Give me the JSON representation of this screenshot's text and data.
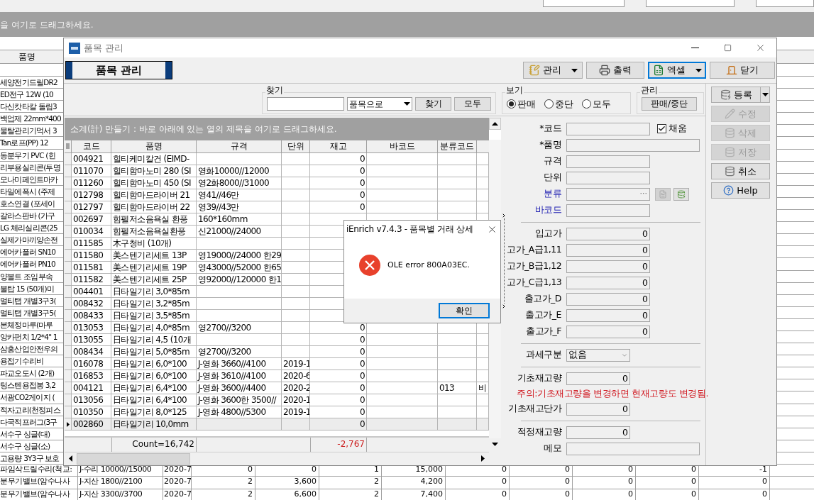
{
  "background_window": {
    "drop_hint": "을 여기로 드래그하세요.",
    "column_header": "품명",
    "list_rows": [
      "세양전기드릴DR2",
      "ED전구 12W (10",
      "다신캇타칼  돌림3",
      "백업제 22mm*400",
      "물탈관리기먹서 3",
      "Tan로프(PP)  12",
      "동분무기 PVC (힌",
      "리부용실리콘(투명",
      "모나미페인트마카",
      "타일에폭시 (주제",
      "호스연결 (포세이",
      "갈라스판바 (가구",
      "LG 체리실리콘(25",
      "실제가마끼양손전",
      "에어카플러 SN10",
      "에어카플러 PN10",
      "양볼트 조임부속",
      "불탑 15 (50개)미",
      "멀티탭 개별3구3(",
      "멀티탭 개별3구5(",
      "본체정마루(마루",
      "앙카펀치 1/2*4\" 1",
      "삼홍산업안전우의",
      "용접기수리비",
      "파교오도시 (2개)",
      "텅스텐용접봉 3,2",
      "서광CO2게이지 (",
      "적자고리(천정피스",
      "다국적프러그(3구",
      "서수구 싱글(대)",
      "서수구 싱글(소)",
      "고용량 3Y3구 보호"
    ],
    "bottom_rows": [
      {
        "name": "파임삭드릴수리(척교:",
        "spec": "J-수리 10000//15000",
        "date": "2020-7",
        "values": [
          "0",
          "0",
          "1",
          "15,000",
          "0",
          "0",
          "0",
          "0",
          "-1"
        ]
      },
      {
        "name": "분무기밸브(암수나사",
        "spec": "J-지산 1800//2100",
        "date": "2020-7",
        "values": [
          "2",
          "3,600",
          "2",
          "4,200",
          "0",
          "0",
          "0",
          "0",
          "0"
        ]
      },
      {
        "name": "분무기밸브(암수나사",
        "spec": "J-지산 3300//3700",
        "date": "2020-7",
        "values": [
          "2",
          "6,600",
          "2",
          "7,400",
          "0",
          "0",
          "0",
          "0",
          "0"
        ]
      }
    ]
  },
  "window": {
    "title": "품목 관리",
    "heading": "품목 관리",
    "toolbar": [
      {
        "label": "관리",
        "dropdown": true,
        "focused": false
      },
      {
        "label": "출력",
        "dropdown": false,
        "focused": false
      },
      {
        "label": "엑셀",
        "dropdown": true,
        "focused": true
      },
      {
        "label": "닫기",
        "dropdown": false,
        "focused": false
      }
    ],
    "search": {
      "title": "찾기",
      "mode": "품목으로",
      "buttons": [
        "찾기",
        "모두"
      ]
    },
    "view": {
      "title": "보기",
      "options": [
        {
          "label": "판매",
          "selected": true
        },
        {
          "label": "중단",
          "selected": false
        },
        {
          "label": "모두",
          "selected": false
        }
      ]
    },
    "manage": {
      "title": "관리",
      "button": "판매/중단"
    },
    "group_hint": "소계(計) 만들기 : 바로 아래에 있는 열의 제목을 여기로 드래그하세요.",
    "table": {
      "columns": [
        "코드",
        "품명",
        "규격",
        "단위",
        "재고",
        "바코드",
        "분류코드"
      ],
      "rows": [
        {
          "code": "004921",
          "name": "힐티케미칼건 (EIMD-",
          "stock": "0",
          "current": false
        },
        {
          "code": "011070",
          "name": "힐티함마노미 280 (SI",
          "spec": "영화10000//12000",
          "stock": "0",
          "current": false
        },
        {
          "code": "011260",
          "name": "힐티함마노미 450 (SI",
          "spec": "영2화8000//31000",
          "stock": "0",
          "current": false
        },
        {
          "code": "012798",
          "name": "힐티함마드라이버 21",
          "spec": "영41//46만",
          "stock": "0",
          "current": false
        },
        {
          "code": "012797",
          "name": "힐티함마드라이버 22",
          "spec": "영39//43만",
          "stock": "0",
          "current": false
        },
        {
          "code": "002697",
          "name": "힘펠저소음욕실 환풍",
          "spec": "160*160mm",
          "current": false
        },
        {
          "code": "010034",
          "name": "힘펠저소음욕실환풍",
          "spec": "신21000//24000",
          "current": false
        },
        {
          "code": "011585",
          "name": "木구청비 (10개)",
          "current": false
        },
        {
          "code": "011580",
          "name": "美스텐기리세트 13P",
          "spec": "영19000//24000 한29",
          "current": false
        },
        {
          "code": "011581",
          "name": "美스텐기리세트 19P",
          "spec": "영43000//52000 한65",
          "current": false
        },
        {
          "code": "011582",
          "name": "美스텐기리세트 25P",
          "spec": "영92000//120000 한1",
          "current": false
        },
        {
          "code": "004401",
          "name": "日타일기리  3,0*85m",
          "current": false
        },
        {
          "code": "008432",
          "name": "日타일기리  3,2*85m",
          "current": false
        },
        {
          "code": "008433",
          "name": "日타일기리  3,5*85m",
          "current": false
        },
        {
          "code": "013053",
          "name": "日타일기리  4,0*85m",
          "spec": "영2700//3200",
          "stock": "0",
          "current": false
        },
        {
          "code": "013055",
          "name": "日타일기리  4,5 (10개",
          "stock": "0",
          "current": false
        },
        {
          "code": "008434",
          "name": "日타일기리  5,0*85m",
          "spec": "영2700//3200",
          "stock": "0",
          "current": false
        },
        {
          "code": "016078",
          "name": "日타일기리  6,0*100",
          "spec": "J-영화 3660//4100",
          "unit": "2019-1",
          "stock": "0",
          "current": false
        },
        {
          "code": "016853",
          "name": "日타일기리  6,0*100",
          "spec": "J-영화 3610//4100",
          "unit": "2020-6",
          "stock": "0",
          "current": false
        },
        {
          "code": "004121",
          "name": "日타일기리  6,4*100",
          "spec": "J-영화 3600//4400",
          "unit": "2020-2",
          "stock": "0",
          "class_code": "013",
          "column_8": "비",
          "current": false
        },
        {
          "code": "013056",
          "name": "日타일기리  6,4*100",
          "spec": "J-영화 3600한 3500//",
          "unit": "2020-1",
          "stock": "0",
          "current": false
        },
        {
          "code": "010350",
          "name": "日타일기리  8,0*125",
          "spec": "J-영화 4800//5300",
          "unit": "2019-1",
          "stock": "0",
          "current": false
        },
        {
          "code": "002860",
          "name": "日타일기리 10,0mm",
          "stock": "0",
          "current": true
        }
      ],
      "footer": {
        "count": "Count=16,742",
        "stock_total": "-2,767"
      }
    },
    "form": [
      {
        "kind": "text",
        "label": "*코드",
        "wide": false,
        "linked": false,
        "check": {
          "label": "채움",
          "checked": true
        }
      },
      {
        "kind": "text",
        "label": "*품명",
        "wide": true,
        "linked": false
      },
      {
        "kind": "text",
        "label": "규격",
        "wide": false,
        "linked": false
      },
      {
        "kind": "text",
        "label": "단위",
        "wide": false,
        "linked": false
      },
      {
        "kind": "lookup",
        "label": "분류",
        "linked": true,
        "ellipsis": "···"
      },
      {
        "kind": "text",
        "label": "바코드",
        "wide": false,
        "linked": true
      },
      {
        "kind": "separator"
      },
      {
        "kind": "number",
        "label": "입고가",
        "value": "0",
        "short": false
      },
      {
        "kind": "number",
        "label": "고가_A급1,11",
        "value": "0",
        "short": false
      },
      {
        "kind": "number",
        "label": "고가_B급1,12",
        "value": "0",
        "short": false
      },
      {
        "kind": "number",
        "label": "고가_C급1,13",
        "value": "0",
        "short": false
      },
      {
        "kind": "number",
        "label": "출고가_D",
        "value": "0",
        "short": false
      },
      {
        "kind": "number",
        "label": "출고가_E",
        "value": "0",
        "short": false
      },
      {
        "kind": "number",
        "label": "출고가_F",
        "value": "0",
        "short": false
      },
      {
        "kind": "separator"
      },
      {
        "kind": "select",
        "label": "과세구분",
        "value": "없음"
      },
      {
        "kind": "separator"
      },
      {
        "kind": "number",
        "label": "기초재고량",
        "value": "0",
        "short": true
      },
      {
        "kind": "warning",
        "text": "주의:기초재고량을 변경하면 현재고량도 변경됨."
      },
      {
        "kind": "number",
        "label": "기초재고단가",
        "value": "0",
        "short": true
      },
      {
        "kind": "separator"
      },
      {
        "kind": "number",
        "label": "적정재고량",
        "value": "0",
        "short": true
      },
      {
        "kind": "text",
        "label": "메모",
        "wide": true,
        "linked": false
      }
    ],
    "side_buttons": [
      {
        "label": "등록",
        "disabled": false,
        "split": true
      },
      {
        "label": "수정",
        "disabled": true,
        "split": false
      },
      {
        "label": "삭제",
        "disabled": true,
        "split": false
      },
      {
        "label": "저장",
        "disabled": true,
        "split": false
      },
      {
        "label": "취소",
        "disabled": false,
        "split": false
      },
      {
        "label": "Help",
        "disabled": false,
        "split": false
      }
    ]
  },
  "dialog": {
    "title": "iEnrich v7.4.3 - 품목별 거래 상세",
    "message": "OLE error 800A03EC.",
    "button": "확인",
    "button_focused": true
  }
}
